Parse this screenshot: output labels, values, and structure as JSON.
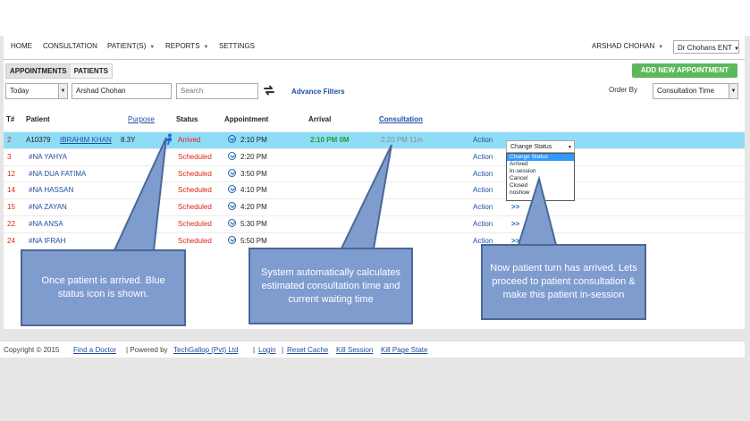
{
  "nav": {
    "home": "HOME",
    "consultation": "CONSULTATION",
    "patients": "PATIENT(S)",
    "reports": "REPORTS",
    "settings": "SETTINGS",
    "user": "ARSHAD CHOHAN",
    "clinic": "Dr Chohans ENT"
  },
  "tabs": [
    "APPOINTMENTS",
    "PATIENTS"
  ],
  "add_button": "ADD NEW APPOINTMENT",
  "filters": {
    "date": "Today",
    "doctor": "Arshad Chohan",
    "search_placeholder": "Search",
    "advance": "Advance Filters",
    "order_by_label": "Order By",
    "order_by": "Consultation Time"
  },
  "columns": {
    "num": "T#",
    "patient": "Patient",
    "purpose": "Purpose",
    "status": "Status",
    "appointment": "Appointment",
    "arrival": "Arrival",
    "consultation": "Consultation"
  },
  "rows": [
    {
      "num": "2",
      "id": "A10379",
      "name": "IBRAHIM KHAN",
      "age": "8.3Y",
      "status": "Arrived",
      "appt": "2:10 PM",
      "arrival": "2:10 PM 0M",
      "consult": "2:20 PM  11m",
      "action": "Action",
      "more": ""
    },
    {
      "num": "3",
      "id": "",
      "name": "#NA YAHYA",
      "age": "",
      "status": "Scheduled",
      "appt": "2:20 PM",
      "arrival": "",
      "consult": "",
      "action": "Action",
      "more": ""
    },
    {
      "num": "12",
      "id": "",
      "name": "#NA DUA FATIMA",
      "age": "",
      "status": "Scheduled",
      "appt": "3:50 PM",
      "arrival": "",
      "consult": "",
      "action": "Action",
      "more": ""
    },
    {
      "num": "14",
      "id": "",
      "name": "#NA HASSAN",
      "age": "",
      "status": "Scheduled",
      "appt": "4:10 PM",
      "arrival": "",
      "consult": "",
      "action": "Action",
      "more": ""
    },
    {
      "num": "15",
      "id": "",
      "name": "#NA ZAYAN",
      "age": "",
      "status": "Scheduled",
      "appt": "4:20 PM",
      "arrival": "",
      "consult": "",
      "action": "Action",
      "more": ">>"
    },
    {
      "num": "22",
      "id": "",
      "name": "#NA ANSA",
      "age": "",
      "status": "Scheduled",
      "appt": "5:30 PM",
      "arrival": "",
      "consult": "",
      "action": "Action",
      "more": ">>"
    },
    {
      "num": "24",
      "id": "",
      "name": "#NA IFRAH",
      "age": "",
      "status": "Scheduled",
      "appt": "5:50 PM",
      "arrival": "",
      "consult": "",
      "action": "Action",
      "more": ">>"
    }
  ],
  "status_dropdown": {
    "selected": "Change Status",
    "options": [
      "Change Status",
      "Arrived",
      "In-session",
      "Cancel",
      "Closed",
      "noshow"
    ]
  },
  "footer": {
    "copyright": "Copyright © 2015",
    "find_doctor": "Find a Doctor",
    "powered_by": "| Powered by",
    "techgallop": "TechGallop (Pvt) Ltd",
    "sep1": "|",
    "login": "Login",
    "sep2": "|",
    "reset_cache": "Reset Cache",
    "kill_session": "Kill Session",
    "kill_page_state": "Kill Page State"
  },
  "callouts": [
    "Once patient is arrived.  Blue status icon is shown.",
    "System automatically calculates estimated consultation time and current waiting time",
    "Now patient turn has arrived. Lets proceed to patient consultation & make this patient in-session"
  ],
  "colors": {
    "highlight_row": "#8fdcf7",
    "add_button": "#5cb85c",
    "callout": "#7f9ccf",
    "link": "#1f4ea3",
    "status_red": "#d21111",
    "arrival_green": "#2a9d2a"
  }
}
